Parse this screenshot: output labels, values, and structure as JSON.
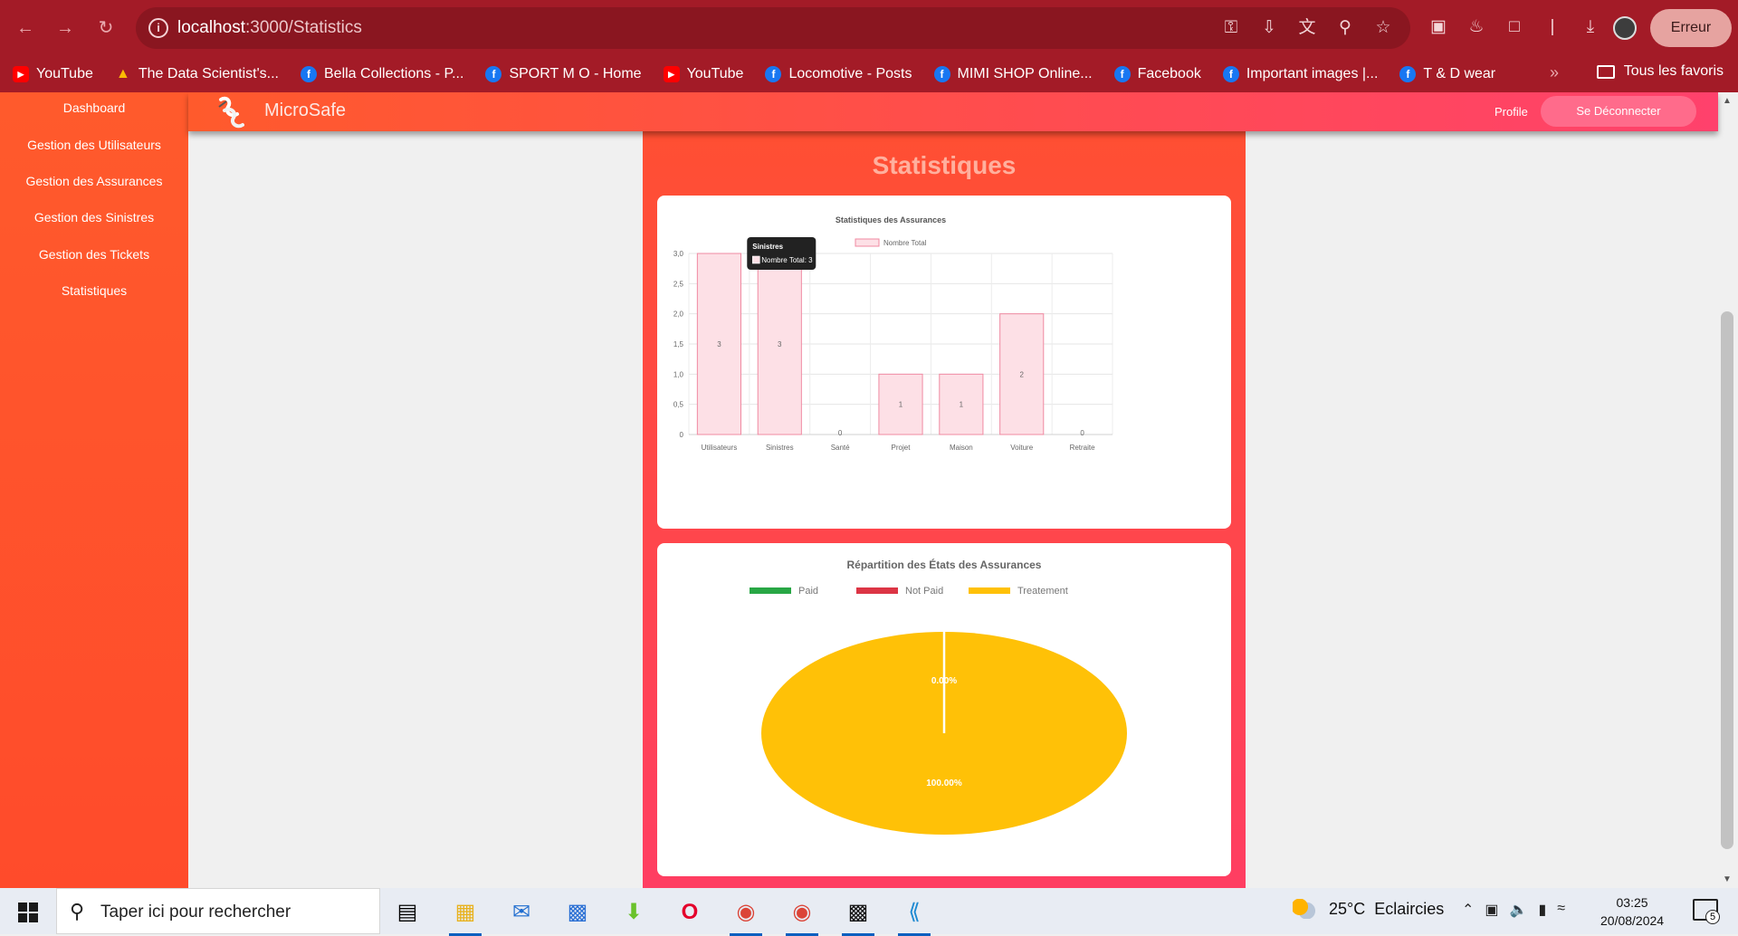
{
  "browser": {
    "url_host": "localhost",
    "url_path": ":3000/Statistics",
    "error_label": "Erreur",
    "bookmarks": [
      {
        "label": "YouTube",
        "icon": "youtube-icon"
      },
      {
        "label": "The Data Scientist's...",
        "icon": "google-drive-icon"
      },
      {
        "label": "Bella Collections - P...",
        "icon": "facebook-icon"
      },
      {
        "label": "SPORT M O - Home",
        "icon": "facebook-icon"
      },
      {
        "label": "YouTube",
        "icon": "youtube-icon"
      },
      {
        "label": "Locomotive - Posts",
        "icon": "facebook-icon"
      },
      {
        "label": "MIMI SHOP Online...",
        "icon": "facebook-icon"
      },
      {
        "label": "Facebook",
        "icon": "facebook-icon"
      },
      {
        "label": "Important images |...",
        "icon": "facebook-icon"
      },
      {
        "label": "T & D wear",
        "icon": "facebook-icon"
      }
    ],
    "all_bookmarks_label": "Tous les favoris"
  },
  "app": {
    "brand": "MicroSafe",
    "profile_label": "Profile",
    "logout_label": "Se Déconnecter",
    "sidebar": [
      {
        "label": "Dashboard"
      },
      {
        "label": "Gestion des Utilisateurs"
      },
      {
        "label": "Gestion des Assurances"
      },
      {
        "label": "Gestion des Sinistres"
      },
      {
        "label": "Gestion des Tickets"
      },
      {
        "label": "Statistiques"
      }
    ],
    "page_title": "Statistiques"
  },
  "chart_data": [
    {
      "type": "bar",
      "title": "Statistiques des Assurances",
      "categories": [
        "Utilisateurs",
        "Sinistres",
        "Santé",
        "Projet",
        "Maison",
        "Voiture",
        "Retraite"
      ],
      "series": [
        {
          "name": "Nombre Total",
          "values": [
            3,
            3,
            0,
            1,
            1,
            2,
            0
          ]
        }
      ],
      "data_labels": [
        "3",
        "3",
        "0",
        "1",
        "1",
        "2",
        "0"
      ],
      "ylim": [
        0,
        3
      ],
      "y_ticks": [
        "0",
        "0,5",
        "1,0",
        "1,5",
        "2,0",
        "2,5",
        "3,0"
      ],
      "grid": true,
      "legend_position": "top",
      "colors": {
        "fill": "#fde0e6",
        "stroke": "#f08aa2"
      },
      "tooltip": {
        "title": "Sinistres",
        "text": "Nombre Total: 3"
      }
    },
    {
      "type": "pie",
      "title": "Répartition des États des Assurances",
      "labels": [
        "Paid",
        "Not Paid",
        "Treatement"
      ],
      "values": [
        0,
        0,
        100
      ],
      "slice_labels": [
        "0.00%",
        "100.00%"
      ],
      "colors": [
        "#28a745",
        "#dc3545",
        "#ffc107"
      ],
      "legend_position": "top"
    }
  ],
  "taskbar": {
    "search_placeholder": "Taper ici pour rechercher",
    "weather_temp": "25°C",
    "weather_text": "Eclaircies",
    "time": "03:25",
    "date": "20/08/2024",
    "notification_count": "5"
  }
}
